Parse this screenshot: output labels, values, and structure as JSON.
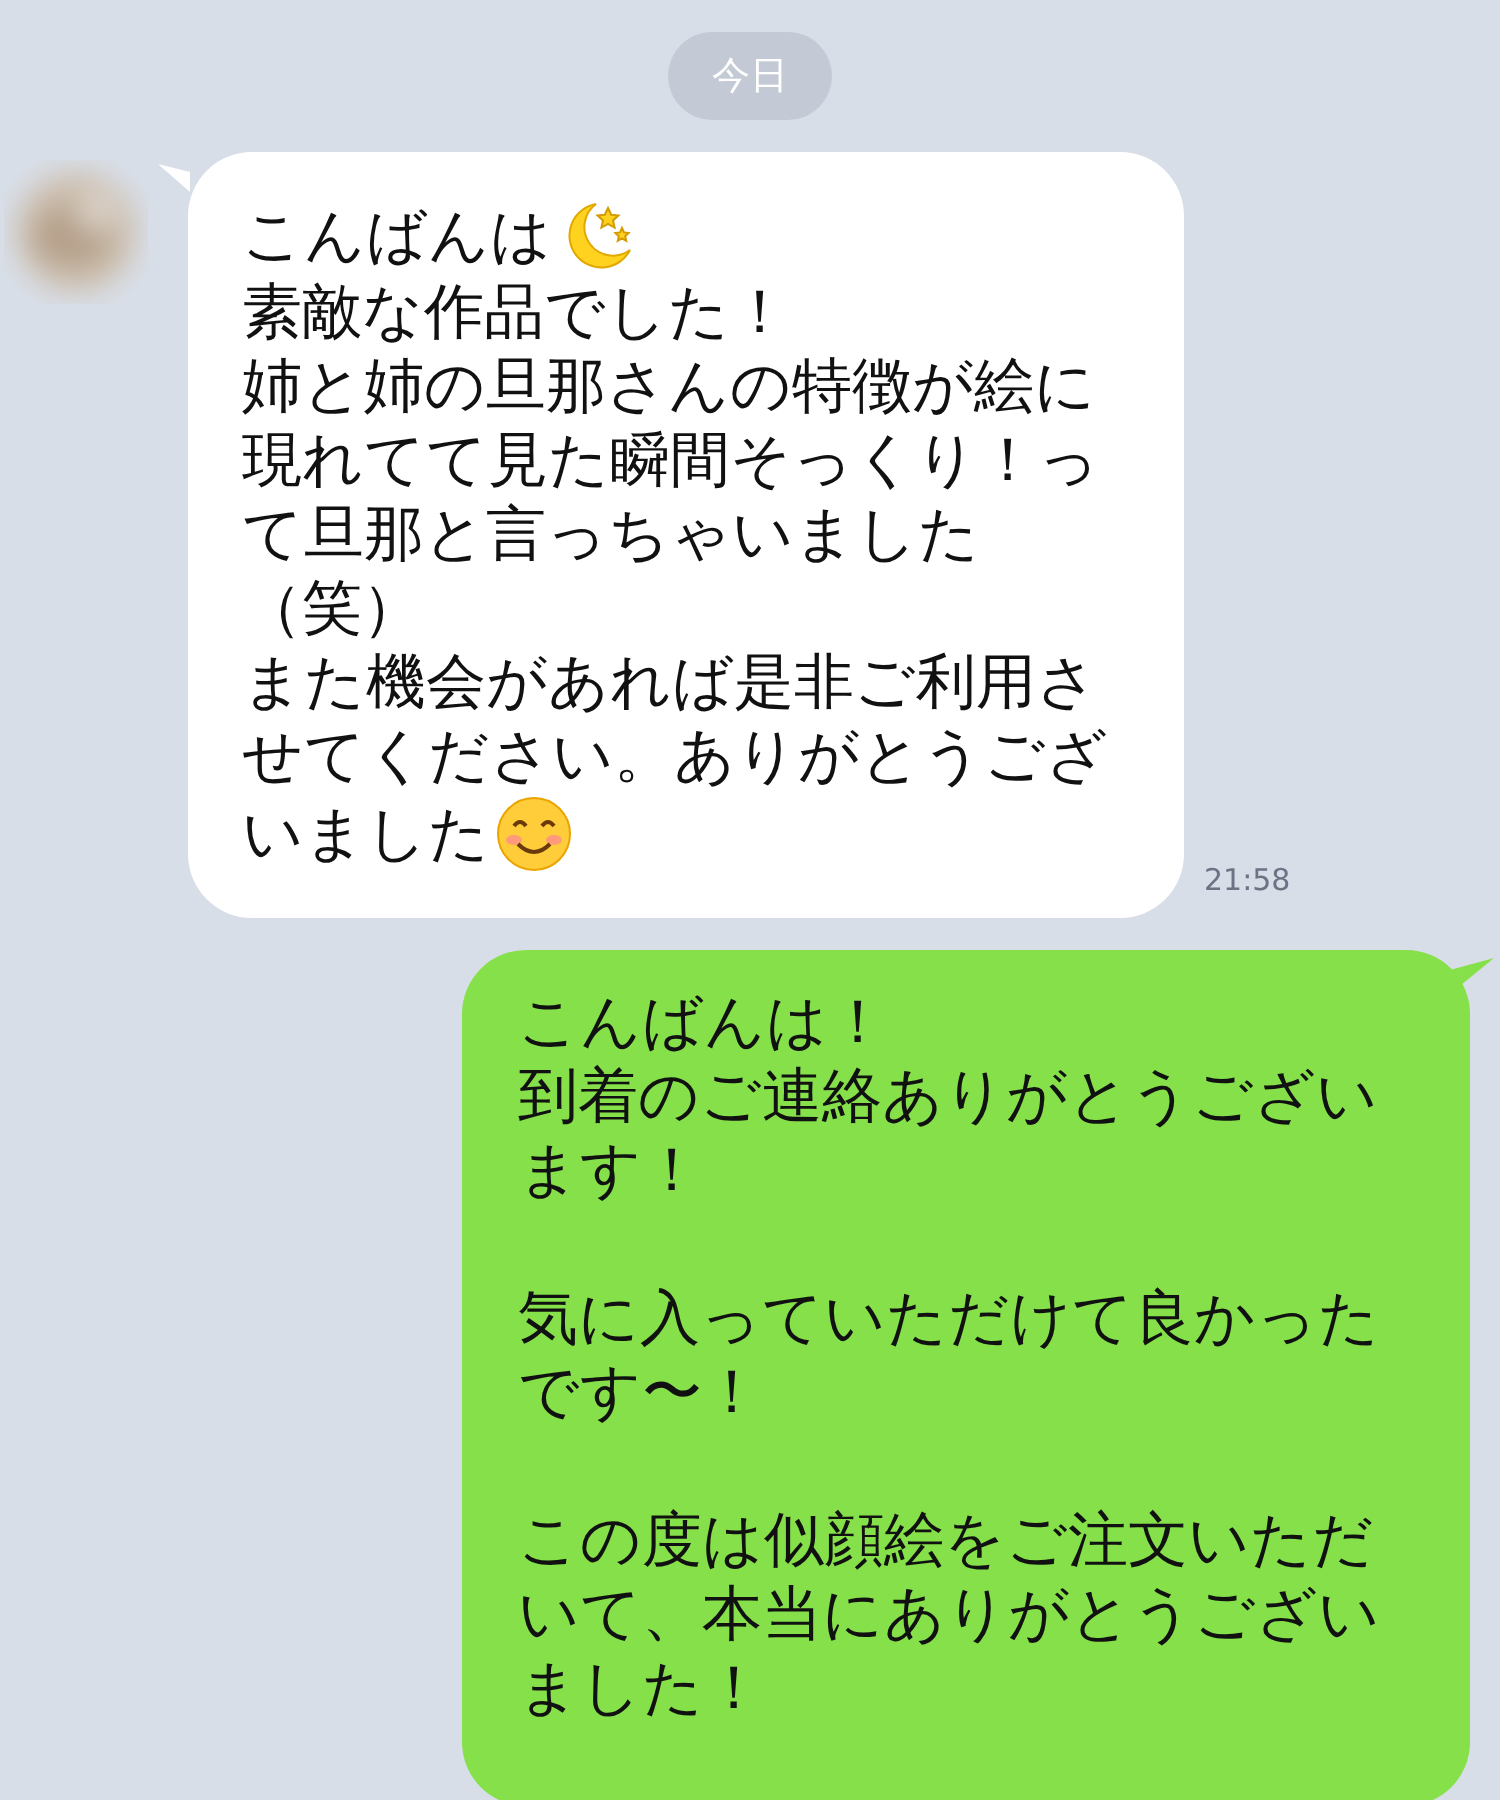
{
  "date_label": "今日",
  "messages": [
    {
      "kind": "incoming",
      "avatar": {
        "kind": "picture"
      },
      "time": "21:58",
      "paragraphs": [
        {
          "lines": [
            {
              "parts": [
                {
                  "kind": "text",
                  "text": "こんばんは"
                },
                {
                  "kind": "moon"
                }
              ]
            },
            {
              "text": "素敵な作品でした！"
            },
            {
              "text": "姉と姉の旦那さんの特徴が絵に"
            },
            {
              "text": "現れてて見た瞬間そっくり！っ"
            },
            {
              "text": "て旦那と言っちゃいました"
            },
            {
              "text": "（笑）"
            },
            {
              "text": "また機会があれば是非ご利用さ"
            },
            {
              "text": "せてください。ありがとうござ"
            },
            {
              "parts": [
                {
                  "kind": "text",
                  "text": "いました"
                },
                {
                  "kind": "smiley"
                }
              ]
            }
          ]
        }
      ]
    },
    {
      "kind": "outgoing",
      "paragraphs": [
        {
          "lines": [
            {
              "text": "こんばんは！"
            },
            {
              "text": "到着のご連絡ありがとうござい"
            },
            {
              "text": "ます！"
            }
          ]
        },
        {
          "lines": [
            {
              "text": "気に入っていただけて良かった"
            },
            {
              "text": "です〜！"
            }
          ]
        },
        {
          "lines": [
            {
              "text": "この度は似顔絵をご注文いただ"
            },
            {
              "text": "いて、本当にありがとうござい"
            },
            {
              "text": "ました！"
            }
          ]
        }
      ]
    }
  ]
}
